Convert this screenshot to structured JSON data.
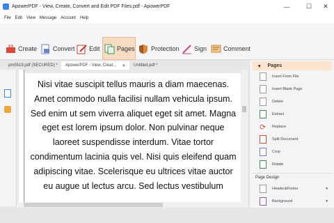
{
  "window": {
    "title": "ApowerPDF - View, Create, Convert and Edit PDF Files.pdf - ApowerPDF"
  },
  "menu": [
    "File",
    "Edit",
    "View",
    "Message",
    "Account",
    "Help"
  ],
  "toolbar": {
    "create": "Create",
    "convert": "Convert",
    "edit": "Edit",
    "pages": "Pages",
    "protection": "Protection",
    "sign": "Sign",
    "comment": "Comment"
  },
  "tabs": [
    "pm5519.pdf (SECURED) *",
    "ApowerPDF - View, Creat...",
    "Untitled.pdf *"
  ],
  "document": {
    "text": "Nisi vitae suscipit tellus mauris a diam maecenas. Amet commodo nulla facilisi nullam vehicula ipsum. Sed enim ut sem viverra aliquet eget sit amet. Magna eget est lorem ipsum dolor. Non pulvinar neque laoreet suspendisse interdum. Vitae tortor condimentum lacinia quis vel. Nisi quis eleifend quam adipiscing vitae. Scelerisque eu ultrices vitae auctor eu augue ut lectus arcu. Sed lectus vestibulum"
  },
  "panel": {
    "title": "Pages",
    "items": [
      "Insert From File",
      "Insert Blank Page",
      "Delete",
      "Extract",
      "Replace",
      "Split Document",
      "Crop",
      "Rotate"
    ],
    "section": "Page Design",
    "design_items": [
      "Header&Footer",
      "Background"
    ]
  },
  "colors": {
    "accent": "#e9b88f",
    "active_bg": "#f7dcc4"
  }
}
